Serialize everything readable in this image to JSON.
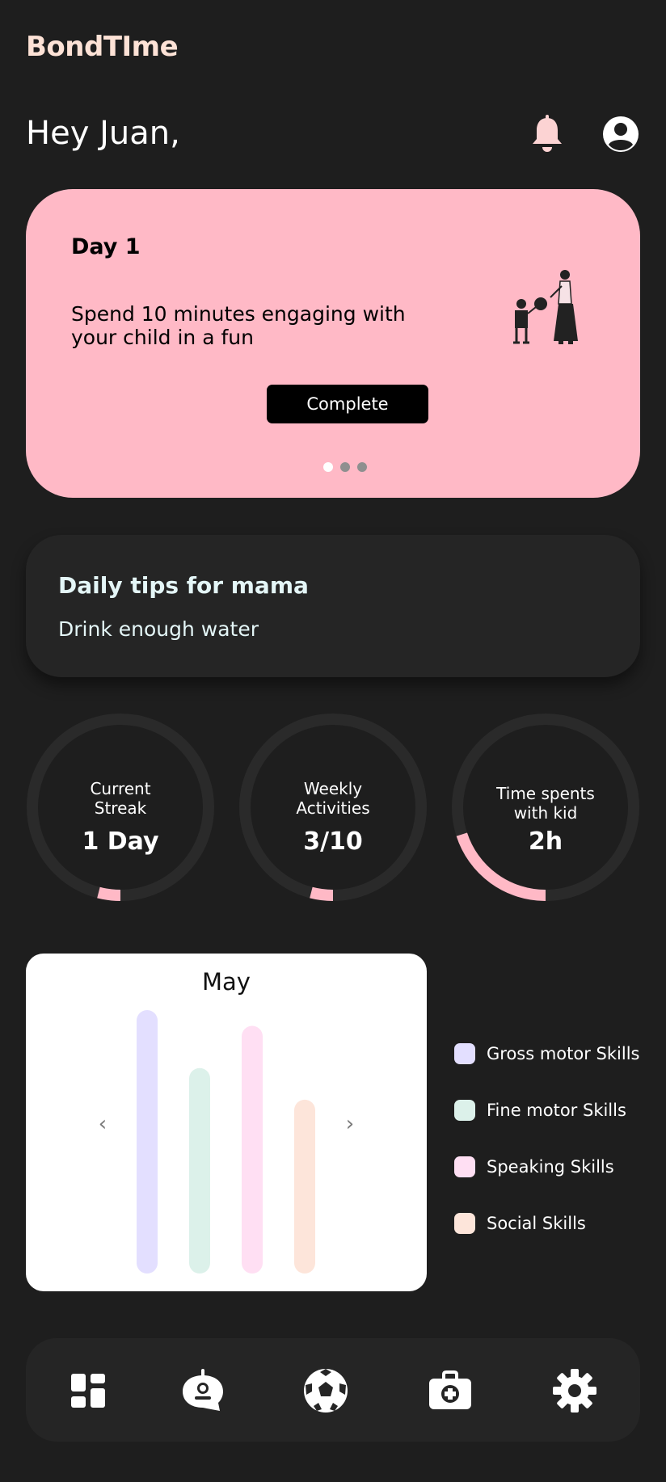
{
  "app": {
    "title": "BondTIme"
  },
  "header": {
    "greeting": "Hey Juan,",
    "icons": [
      "bell-icon",
      "user-icon"
    ]
  },
  "task_card": {
    "day": "Day 1",
    "text": "Spend 10 minutes engaging with your child in a fun",
    "button_label": "Complete",
    "carousel": {
      "total": 3,
      "active": 1
    },
    "colors": {
      "background": "#ffb9c6"
    }
  },
  "tips": {
    "title": "Daily tips for mama",
    "text": "Drink enough water"
  },
  "stats": [
    {
      "label_line1": "Current",
      "label_line2": "Streak",
      "value": "1 Day",
      "progress": 0.04
    },
    {
      "label_line1": "Weekly",
      "label_line2": "Activities",
      "value": "3/10",
      "progress": 0.04
    },
    {
      "label_line1": "Time spents",
      "label_line2": "with kid",
      "value": "2h",
      "progress": 0.2
    }
  ],
  "chart_data": {
    "type": "bar",
    "title": "May",
    "xlabel": "",
    "ylabel": "",
    "categories": [
      "Gross motor Skills",
      "Fine motor Skills",
      "Speaking Skills",
      "Social Skills"
    ],
    "values": [
      100,
      78,
      94,
      66
    ],
    "ylim": [
      0,
      100
    ],
    "grid": false,
    "legend": "right",
    "colors": [
      "#e3dfff",
      "#dcf1ea",
      "#ffdff3",
      "#fde5da"
    ]
  },
  "chart_nav": {
    "prev": "‹",
    "next": "›"
  },
  "bottom_nav": {
    "items": [
      {
        "name": "dashboard-icon"
      },
      {
        "name": "baby-monitor-icon"
      },
      {
        "name": "soccer-ball-icon"
      },
      {
        "name": "first-aid-kit-icon"
      },
      {
        "name": "settings-gear-icon"
      }
    ]
  },
  "theme": {
    "background": "#1e1e1e",
    "card": "#252525",
    "accent": "#ffb9c6",
    "logo": "#fde2d6"
  }
}
